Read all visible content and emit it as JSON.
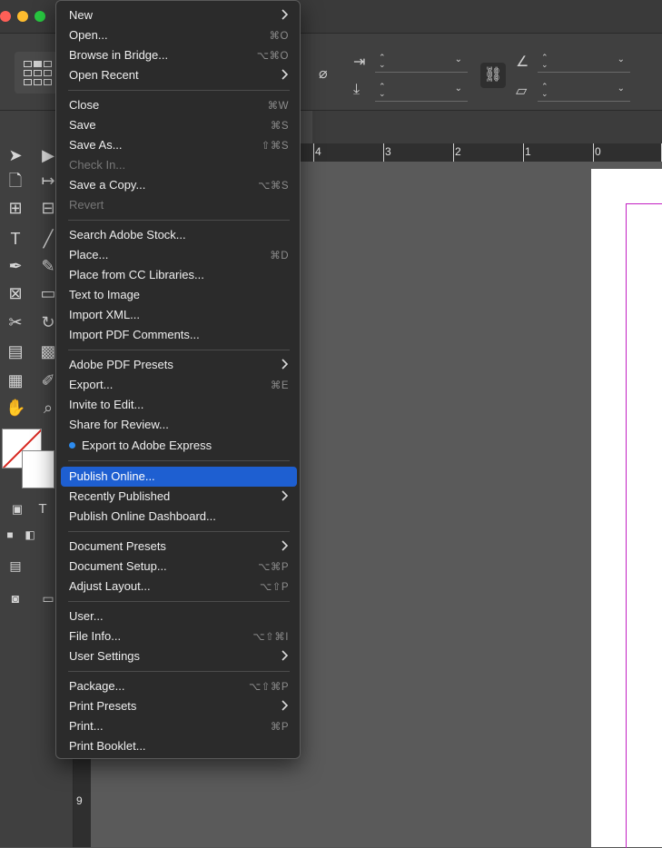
{
  "colors": {
    "menu_bg": "#2b2b2b",
    "highlight": "#1e5fd1",
    "margin_guide": "#c31fc3",
    "bullet": "#2d8cf0"
  },
  "ruler": {
    "h_labels": [
      "4",
      "3",
      "2",
      "1",
      "0"
    ],
    "v_label": "9"
  },
  "file_menu": {
    "items": [
      {
        "label": "New",
        "shortcut": "",
        "submenu": true
      },
      {
        "label": "Open...",
        "shortcut": "⌘O"
      },
      {
        "label": "Browse in Bridge...",
        "shortcut": "⌥⌘O"
      },
      {
        "label": "Open Recent",
        "shortcut": "",
        "submenu": true
      },
      {
        "label": "Close",
        "shortcut": "⌘W"
      },
      {
        "label": "Save",
        "shortcut": "⌘S"
      },
      {
        "label": "Save As...",
        "shortcut": "⇧⌘S"
      },
      {
        "label": "Check In...",
        "shortcut": "",
        "disabled": true
      },
      {
        "label": "Save a Copy...",
        "shortcut": "⌥⌘S"
      },
      {
        "label": "Revert",
        "shortcut": "",
        "disabled": true
      },
      {
        "label": "Search Adobe Stock...",
        "shortcut": ""
      },
      {
        "label": "Place...",
        "shortcut": "⌘D"
      },
      {
        "label": "Place from CC Libraries...",
        "shortcut": ""
      },
      {
        "label": "Text to Image",
        "shortcut": ""
      },
      {
        "label": "Import XML...",
        "shortcut": ""
      },
      {
        "label": "Import PDF Comments...",
        "shortcut": ""
      },
      {
        "label": "Adobe PDF Presets",
        "shortcut": "",
        "submenu": true
      },
      {
        "label": "Export...",
        "shortcut": "⌘E"
      },
      {
        "label": "Invite to Edit...",
        "shortcut": ""
      },
      {
        "label": "Share for Review...",
        "shortcut": ""
      },
      {
        "label": "Export to Adobe Express",
        "shortcut": "",
        "bullet": true
      },
      {
        "label": "Publish Online...",
        "shortcut": "",
        "highlight": true
      },
      {
        "label": "Recently Published",
        "shortcut": "",
        "submenu": true
      },
      {
        "label": "Publish Online Dashboard...",
        "shortcut": ""
      },
      {
        "label": "Document Presets",
        "shortcut": "",
        "submenu": true
      },
      {
        "label": "Document Setup...",
        "shortcut": "⌥⌘P"
      },
      {
        "label": "Adjust Layout...",
        "shortcut": "⌥⇧P"
      },
      {
        "label": "User...",
        "shortcut": ""
      },
      {
        "label": "File Info...",
        "shortcut": "⌥⇧⌘I"
      },
      {
        "label": "User Settings",
        "shortcut": "",
        "submenu": true
      },
      {
        "label": "Package...",
        "shortcut": "⌥⇧⌘P"
      },
      {
        "label": "Print Presets",
        "shortcut": "",
        "submenu": true
      },
      {
        "label": "Print...",
        "shortcut": "⌘P"
      },
      {
        "label": "Print Booklet...",
        "shortcut": ""
      }
    ]
  }
}
